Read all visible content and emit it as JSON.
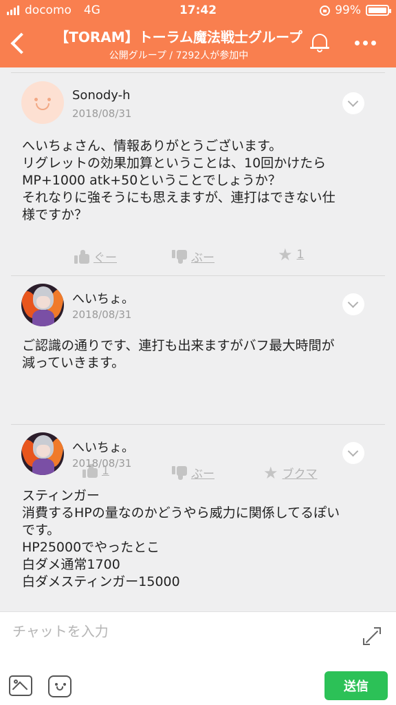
{
  "status_bar": {
    "carrier": "docomo",
    "network": "4G",
    "time": "17:42",
    "battery": "99%"
  },
  "header": {
    "title": "【TORAM】トーラム魔法戦士グループ",
    "subtitle": "公開グループ / 7292人が参加中"
  },
  "messages": [
    {
      "name": "Sonody-h",
      "date": "2018/08/31",
      "avatar": "default-face-avatar",
      "lines": [
        "へいちょさん、情報ありがとうございます。",
        "リグレットの効果加算ということは、10回かけたら",
        "MP+1000 atk+50ということでしょうか？",
        "それなりに強そうにも思えますが、連打はできない仕",
        "様ですか？"
      ],
      "reactions": {
        "like": "ぐー",
        "dislike": "ぶー",
        "bookmark": "1"
      }
    },
    {
      "name": "へいちょ。",
      "date": "2018/08/31",
      "avatar": "anime-character-avatar",
      "lines": [
        "ご認識の通りです、連打も出来ますがバフ最大時間が",
        "減っていきます。"
      ],
      "reactions": {
        "like": "1",
        "dislike": "ぶー",
        "bookmark": "ブクマ"
      }
    },
    {
      "name": "へいちょ。",
      "date": "2018/08/31",
      "avatar": "anime-character-avatar",
      "lines": [
        "スティンガー",
        "消費するHPの量なのかどうやら威力に関係してるぽい",
        "です。",
        "HP25000でやったとこ",
        "白ダメ通常1700",
        "白ダメスティンガー15000"
      ]
    }
  ],
  "composer": {
    "placeholder": "チャットを入力",
    "send_label": "送信"
  },
  "colors": {
    "header_bg": "#f97f4f",
    "send_button": "#2cc157"
  }
}
